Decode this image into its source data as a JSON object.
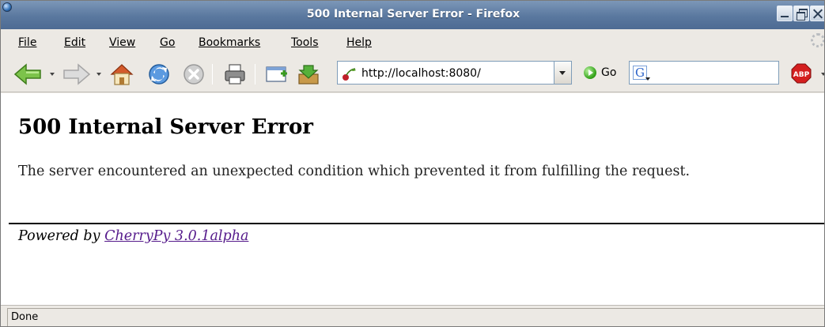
{
  "window": {
    "title": "500 Internal Server Error - Firefox"
  },
  "menu": {
    "items": [
      {
        "label": "File",
        "accesskey": "F"
      },
      {
        "label": "Edit",
        "accesskey": "E"
      },
      {
        "label": "View",
        "accesskey": "V"
      },
      {
        "label": "Go",
        "accesskey": "G"
      },
      {
        "label": "Bookmarks",
        "accesskey": "B"
      },
      {
        "label": "Tools",
        "accesskey": "T"
      },
      {
        "label": "Help",
        "accesskey": "H"
      }
    ]
  },
  "toolbar": {
    "icons": [
      "back-icon",
      "forward-icon",
      "home-icon",
      "reload-icon",
      "stop-icon",
      "print-icon",
      "new-window-icon",
      "downloads-icon"
    ],
    "url": "http://localhost:8080/",
    "go_label": "Go",
    "search_value": "",
    "search_engine_icon": "G",
    "adblock_label": "ABP"
  },
  "page": {
    "heading": "500 Internal Server Error",
    "message": "The server encountered an unexpected condition which prevented it from fulfilling the request.",
    "powered_prefix": "Powered by ",
    "powered_link": "CherryPy 3.0.1alpha"
  },
  "status": {
    "text": "Done"
  },
  "colors": {
    "titlebar": "#5a789f",
    "chrome": "#ece9e4",
    "visited_link": "#551a8b"
  }
}
